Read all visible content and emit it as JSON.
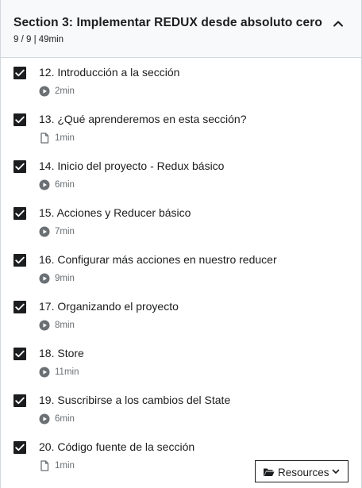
{
  "section": {
    "title": "Section 3: Implementar REDUX desde absoluto cero",
    "progress": "9 / 9",
    "duration": "49min",
    "meta": "9 / 9 | 49min",
    "expanded": true
  },
  "lectures": [
    {
      "title": "12. Introducción a la sección",
      "type": "video",
      "duration": "2min",
      "completed": true
    },
    {
      "title": "13. ¿Qué aprenderemos en esta sección?",
      "type": "article",
      "duration": "1min",
      "completed": true
    },
    {
      "title": "14. Inicio del proyecto - Redux básico",
      "type": "video",
      "duration": "6min",
      "completed": true
    },
    {
      "title": "15. Acciones y Reducer básico",
      "type": "video",
      "duration": "7min",
      "completed": true
    },
    {
      "title": "16. Configurar más acciones en nuestro reducer",
      "type": "video",
      "duration": "9min",
      "completed": true
    },
    {
      "title": "17. Organizando el proyecto",
      "type": "video",
      "duration": "8min",
      "completed": true
    },
    {
      "title": "18. Store",
      "type": "video",
      "duration": "11min",
      "completed": true
    },
    {
      "title": "19. Suscribirse a los cambios del State",
      "type": "video",
      "duration": "6min",
      "completed": true
    },
    {
      "title": "20. Código fuente de la sección",
      "type": "article",
      "duration": "1min",
      "completed": true
    }
  ],
  "resources_button": {
    "label": "Resources",
    "icon": "folder-open-icon"
  },
  "colors": {
    "header_bg": "#f7f9fa",
    "text": "#1c1d1f",
    "muted": "#6a6f73",
    "border": "#d1d7dc"
  }
}
